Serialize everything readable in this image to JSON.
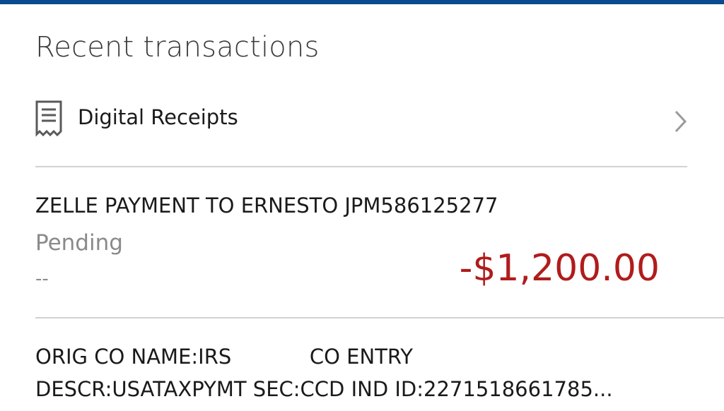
{
  "header": {
    "title": "Recent transactions"
  },
  "receipts": {
    "label": "Digital Receipts",
    "icon": "receipt-icon",
    "chevron_icon": "chevron-right-icon"
  },
  "transactions": [
    {
      "description": "ZELLE PAYMENT TO ERNESTO JPM586125277",
      "status": "Pending",
      "date": "--",
      "amount": "-$1,200.00",
      "amount_color": "#b01c1c"
    },
    {
      "description_line1": "ORIG CO NAME:IRS            CO ENTRY",
      "description_line2": "DESCR:USATAXPYMT SEC:CCD IND ID:2271518661785..."
    }
  ],
  "colors": {
    "top_bar": "#0a4a8f",
    "divider": "#d2d2d2",
    "muted_text": "#8a8a8a",
    "negative_amount": "#b01c1c"
  }
}
